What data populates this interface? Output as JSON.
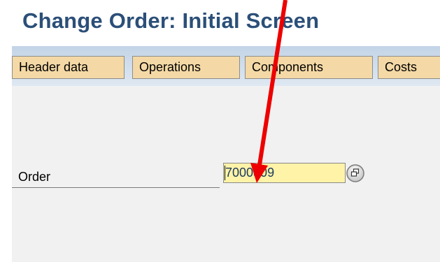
{
  "header": {
    "title": "Change Order: Initial Screen"
  },
  "toolbar": {
    "buttons": [
      {
        "label": "Header data"
      },
      {
        "label": "Operations"
      },
      {
        "label": "Components"
      },
      {
        "label": "Costs"
      }
    ]
  },
  "form": {
    "order_label": "Order",
    "order_value": "7000309"
  },
  "icons": {
    "possible_entries": "possible-entries-icon",
    "annotation": "red-arrow-icon"
  },
  "colors": {
    "title": "#2b4f78",
    "toolbar_button": "#f4d9a6",
    "input_background": "#fff3a8",
    "annotation_arrow": "#ee0000"
  }
}
